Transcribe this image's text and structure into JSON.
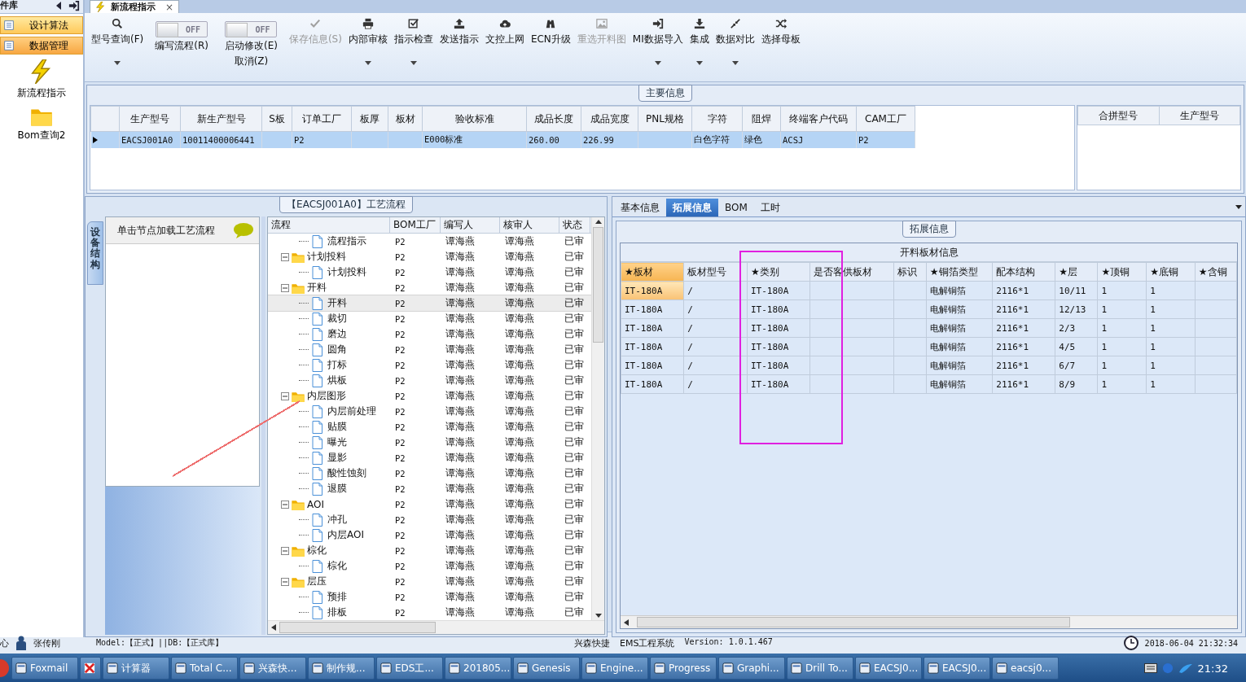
{
  "sidebar": {
    "title": "件库",
    "groups": [
      {
        "label": "设计算法",
        "selected": false
      },
      {
        "label": "数据管理",
        "selected": true
      }
    ],
    "shortcuts": [
      {
        "label": "新流程指示"
      },
      {
        "label": "Bom查询2"
      }
    ]
  },
  "document_tab": {
    "title": "新流程指示",
    "close": "×"
  },
  "toolbar": [
    {
      "kind": "button",
      "label": "型号查询(F)",
      "dropdown": true,
      "disabled": false
    },
    {
      "kind": "toggle",
      "label": "编写流程(R)",
      "toggle_text": "OFF",
      "on": false
    },
    {
      "kind": "toggle",
      "label": "启动修改(E)",
      "sublabel": "取消(Z)",
      "toggle_text": "OFF",
      "on": false
    },
    {
      "kind": "button",
      "label": "保存信息(S)",
      "dropdown": false,
      "disabled": true
    },
    {
      "kind": "button",
      "label": "内部审核",
      "dropdown": true,
      "disabled": false
    },
    {
      "kind": "button",
      "label": "指示检查",
      "dropdown": true,
      "disabled": false
    },
    {
      "kind": "button",
      "label": "发送指示",
      "dropdown": false,
      "disabled": false
    },
    {
      "kind": "button",
      "label": "文控上网",
      "dropdown": false,
      "disabled": false
    },
    {
      "kind": "button",
      "label": "ECN升级",
      "dropdown": false,
      "disabled": false
    },
    {
      "kind": "button",
      "label": "重选开料图",
      "dropdown": false,
      "disabled": true
    },
    {
      "kind": "button",
      "label": "MI数据导入",
      "dropdown": true,
      "disabled": false
    },
    {
      "kind": "button",
      "label": "集成",
      "dropdown": true,
      "disabled": false
    },
    {
      "kind": "button",
      "label": "数据对比",
      "dropdown": true,
      "disabled": false
    },
    {
      "kind": "button",
      "label": "选择母板",
      "dropdown": false,
      "disabled": false
    }
  ],
  "main_info": {
    "title": "主要信息",
    "columns": [
      "生产型号",
      "新生产型号",
      "S板",
      "订单工厂",
      "板厚",
      "板材",
      "验收标准",
      "成品长度",
      "成品宽度",
      "PNL规格",
      "字符",
      "阻焊",
      "终端客户代码",
      "CAM工厂"
    ],
    "rows": [
      {
        "selected": true,
        "cells": [
          "EACSJ001A0",
          "10011400006441",
          null,
          "P2",
          null,
          null,
          "E000标准",
          "260.00",
          "226.99",
          null,
          "白色字符",
          "绿色",
          "ACSJ",
          "P2"
        ]
      }
    ],
    "merge_columns": [
      "合拼型号",
      "生产型号"
    ]
  },
  "flow_panel": {
    "title": "【EACSJ001A0】工艺流程",
    "side_tab": "设备结构",
    "hint": "单击节点加载工艺流程",
    "columns": [
      "流程",
      "BOM工厂",
      "编写人",
      "核审人",
      "状态"
    ],
    "tree": [
      {
        "kind": "step",
        "label": "流程指示",
        "selected": false,
        "bom_factory": "P2",
        "writer": "谭海燕",
        "reviewer": "谭海燕",
        "status": "已审"
      },
      {
        "kind": "stage",
        "label": "计划投料",
        "expanded": true,
        "selected": false,
        "bom_factory": "P2",
        "writer": "谭海燕",
        "reviewer": "谭海燕",
        "status": "已审",
        "children": [
          {
            "kind": "step",
            "label": "计划投料",
            "selected": false,
            "bom_factory": "P2",
            "writer": "谭海燕",
            "reviewer": "谭海燕",
            "status": "已审"
          }
        ]
      },
      {
        "kind": "stage",
        "label": "开料",
        "expanded": true,
        "selected": false,
        "bom_factory": "P2",
        "writer": "谭海燕",
        "reviewer": "谭海燕",
        "status": "已审",
        "children": [
          {
            "kind": "step",
            "label": "开料",
            "selected": true,
            "bom_factory": "P2",
            "writer": "谭海燕",
            "reviewer": "谭海燕",
            "status": "已审"
          },
          {
            "kind": "step",
            "label": "裁切",
            "selected": false,
            "bom_factory": "P2",
            "writer": "谭海燕",
            "reviewer": "谭海燕",
            "status": "已审"
          },
          {
            "kind": "step",
            "label": "磨边",
            "selected": false,
            "bom_factory": "P2",
            "writer": "谭海燕",
            "reviewer": "谭海燕",
            "status": "已审"
          },
          {
            "kind": "step",
            "label": "圆角",
            "selected": false,
            "bom_factory": "P2",
            "writer": "谭海燕",
            "reviewer": "谭海燕",
            "status": "已审"
          },
          {
            "kind": "step",
            "label": "打标",
            "selected": false,
            "bom_factory": "P2",
            "writer": "谭海燕",
            "reviewer": "谭海燕",
            "status": "已审"
          },
          {
            "kind": "step",
            "label": "烘板",
            "selected": false,
            "bom_factory": "P2",
            "writer": "谭海燕",
            "reviewer": "谭海燕",
            "status": "已审"
          }
        ]
      },
      {
        "kind": "stage",
        "label": "内层图形",
        "expanded": true,
        "selected": false,
        "bom_factory": "P2",
        "writer": "谭海燕",
        "reviewer": "谭海燕",
        "status": "已审",
        "children": [
          {
            "kind": "step",
            "label": "内层前处理",
            "selected": false,
            "bom_factory": "P2",
            "writer": "谭海燕",
            "reviewer": "谭海燕",
            "status": "已审"
          },
          {
            "kind": "step",
            "label": "贴膜",
            "selected": false,
            "bom_factory": "P2",
            "writer": "谭海燕",
            "reviewer": "谭海燕",
            "status": "已审"
          },
          {
            "kind": "step",
            "label": "曝光",
            "selected": false,
            "bom_factory": "P2",
            "writer": "谭海燕",
            "reviewer": "谭海燕",
            "status": "已审"
          },
          {
            "kind": "step",
            "label": "显影",
            "selected": false,
            "bom_factory": "P2",
            "writer": "谭海燕",
            "reviewer": "谭海燕",
            "status": "已审"
          },
          {
            "kind": "step",
            "label": "酸性蚀刻",
            "selected": false,
            "bom_factory": "P2",
            "writer": "谭海燕",
            "reviewer": "谭海燕",
            "status": "已审"
          },
          {
            "kind": "step",
            "label": "退膜",
            "selected": false,
            "bom_factory": "P2",
            "writer": "谭海燕",
            "reviewer": "谭海燕",
            "status": "已审"
          }
        ]
      },
      {
        "kind": "stage",
        "label": "AOI",
        "expanded": true,
        "selected": false,
        "bom_factory": "P2",
        "writer": "谭海燕",
        "reviewer": "谭海燕",
        "status": "已审",
        "children": [
          {
            "kind": "step",
            "label": "冲孔",
            "selected": false,
            "bom_factory": "P2",
            "writer": "谭海燕",
            "reviewer": "谭海燕",
            "status": "已审"
          },
          {
            "kind": "step",
            "label": "内层AOI",
            "selected": false,
            "bom_factory": "P2",
            "writer": "谭海燕",
            "reviewer": "谭海燕",
            "status": "已审"
          }
        ]
      },
      {
        "kind": "stage",
        "label": "棕化",
        "expanded": true,
        "selected": false,
        "bom_factory": "P2",
        "writer": "谭海燕",
        "reviewer": "谭海燕",
        "status": "已审",
        "children": [
          {
            "kind": "step",
            "label": "棕化",
            "selected": false,
            "bom_factory": "P2",
            "writer": "谭海燕",
            "reviewer": "谭海燕",
            "status": "已审"
          }
        ]
      },
      {
        "kind": "stage",
        "label": "层压",
        "expanded": true,
        "selected": false,
        "bom_factory": "P2",
        "writer": "谭海燕",
        "reviewer": "谭海燕",
        "status": "已审",
        "children": [
          {
            "kind": "step",
            "label": "预排",
            "selected": false,
            "bom_factory": "P2",
            "writer": "谭海燕",
            "reviewer": "谭海燕",
            "status": "已审"
          },
          {
            "kind": "step",
            "label": "排板",
            "selected": false,
            "bom_factory": "P2",
            "writer": "谭海燕",
            "reviewer": "谭海燕",
            "status": "已审"
          }
        ]
      }
    ]
  },
  "detail_panel": {
    "tabs": [
      {
        "label": "基本信息",
        "selected": false
      },
      {
        "label": "拓展信息",
        "selected": true
      },
      {
        "label": "BOM",
        "selected": false
      },
      {
        "label": "工时",
        "selected": false
      }
    ],
    "group_title": "拓展信息",
    "table_title": "开料板材信息",
    "columns": [
      {
        "label": "★板材",
        "selected": true
      },
      {
        "label": "板材型号",
        "selected": false
      },
      {
        "label": "★类别",
        "selected": false
      },
      {
        "label": "是否客供板材",
        "selected": false
      },
      {
        "label": "标识",
        "selected": false
      },
      {
        "label": "★铜箔类型",
        "selected": false
      },
      {
        "label": "配本结构",
        "selected": false
      },
      {
        "label": "★层",
        "selected": false
      },
      {
        "label": "★顶铜",
        "selected": false
      },
      {
        "label": "★底铜",
        "selected": false
      },
      {
        "label": "★含铜",
        "selected": false
      }
    ],
    "rows": [
      {
        "selected": true,
        "cells": [
          "IT-180A",
          "/",
          "IT-180A",
          null,
          null,
          "电解铜箔",
          "2116*1",
          "10/11",
          "1",
          "1",
          null
        ]
      },
      {
        "selected": false,
        "cells": [
          "IT-180A",
          "/",
          "IT-180A",
          null,
          null,
          "电解铜箔",
          "2116*1",
          "12/13",
          "1",
          "1",
          null
        ]
      },
      {
        "selected": false,
        "cells": [
          "IT-180A",
          "/",
          "IT-180A",
          null,
          null,
          "电解铜箔",
          "2116*1",
          "2/3",
          "1",
          "1",
          null
        ]
      },
      {
        "selected": false,
        "cells": [
          "IT-180A",
          "/",
          "IT-180A",
          null,
          null,
          "电解铜箔",
          "2116*1",
          "4/5",
          "1",
          "1",
          null
        ]
      },
      {
        "selected": false,
        "cells": [
          "IT-180A",
          "/",
          "IT-180A",
          null,
          null,
          "电解铜箔",
          "2116*1",
          "6/7",
          "1",
          "1",
          null
        ]
      },
      {
        "selected": false,
        "cells": [
          "IT-180A",
          "/",
          "IT-180A",
          null,
          null,
          "电解铜箔",
          "2116*1",
          "8/9",
          "1",
          "1",
          null
        ]
      }
    ]
  },
  "status_bar": {
    "section": "心",
    "user": "张传刚",
    "model": "Model:【正式】||DB:【正式库】",
    "company": "兴森快捷",
    "system": "EMS工程系统",
    "version": "Version: 1.0.1.467",
    "datetime": "2018-06-04 21:32:34"
  },
  "taskbar": {
    "items": [
      {
        "kind": "app",
        "label": "Foxmail"
      },
      {
        "kind": "icon_only"
      },
      {
        "kind": "app",
        "label": "计算器"
      },
      {
        "kind": "app",
        "label": "Total C..."
      },
      {
        "kind": "app",
        "label": "兴森快..."
      },
      {
        "kind": "app",
        "label": "制作规..."
      },
      {
        "kind": "app",
        "label": "EDS工..."
      },
      {
        "kind": "app",
        "label": "201805..."
      },
      {
        "kind": "app",
        "label": "Genesis"
      },
      {
        "kind": "app",
        "label": "Engine..."
      },
      {
        "kind": "app",
        "label": "Progress"
      },
      {
        "kind": "app",
        "label": "Graphi..."
      },
      {
        "kind": "app",
        "label": "Drill To..."
      },
      {
        "kind": "app",
        "label": "EACSJ0..."
      },
      {
        "kind": "app",
        "label": "EACSJ0..."
      },
      {
        "kind": "app",
        "label": "eacsj0..."
      }
    ],
    "clock": "21:32"
  },
  "annotations": [
    {
      "kind": "arrow_line",
      "color": "#ee7070"
    },
    {
      "kind": "highlight_box",
      "color": "#e020e0"
    }
  ]
}
